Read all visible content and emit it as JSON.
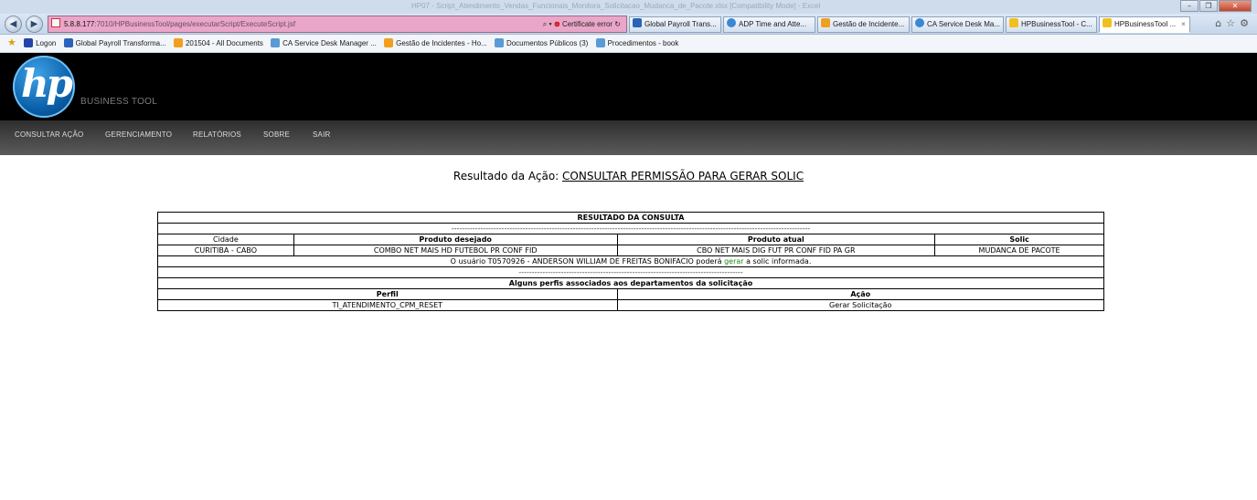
{
  "browser": {
    "window_title": "HP07 - Script_Atendimento_Vendas_Funcionais_Monitora_Solicitacao_Mudanca_de_Pacote.xlsx [Compatibility Mode] - Excel",
    "url_host": "5.8.8.177",
    "url_rest": ":7010/HPBusinessTool/pages/executarScript/ExecuteScript.jsf",
    "certificate_error": "Certificate error",
    "tabs": [
      {
        "label": "Global Payroll Trans...",
        "color": "#2a63b8"
      },
      {
        "label": "ADP Time and Atte...",
        "color": "#3a87d6"
      },
      {
        "label": "Gestão de Incidente...",
        "color": "#f0a020"
      },
      {
        "label": "CA Service Desk Ma...",
        "color": "#3a87d6"
      },
      {
        "label": "HPBusinessTool - C...",
        "color": "#f0c020"
      },
      {
        "label": "HPBusinessTool ...",
        "color": "#f0c020"
      }
    ],
    "favorites": [
      {
        "label": "Logon",
        "color": "#2244aa"
      },
      {
        "label": "Global Payroll Transforma...",
        "color": "#2a63b8"
      },
      {
        "label": "201504 - All Documents",
        "color": "#f0a020"
      },
      {
        "label": "CA Service Desk Manager ...",
        "color": "#5a9ad6"
      },
      {
        "label": "Gestão de Incidentes - Ho...",
        "color": "#f0a020"
      },
      {
        "label": "Documentos Públicos (3)",
        "color": "#5a9ad6"
      },
      {
        "label": "Procedimentos - book",
        "color": "#5a9ad6"
      }
    ]
  },
  "header": {
    "logo_text": "hp",
    "brand_sub": "BUSINESS TOOL"
  },
  "menu": {
    "items": [
      {
        "label": "CONSULTAR AÇÃO"
      },
      {
        "label": "GERENCIAMENTO"
      },
      {
        "label": "RELATÓRIOS"
      },
      {
        "label": "SOBRE"
      },
      {
        "label": "SAIR"
      }
    ]
  },
  "result": {
    "heading_prefix": "Resultado da Ação: ",
    "action_name": "CONSULTAR PERMISSÃO PARA GERAR SOLIC",
    "table_title": "RESULTADO DA CONSULTA",
    "separator": "----------------------------------------------------------------------------------------------------------------------------------------",
    "columns": [
      "Cidade",
      "Produto desejado",
      "Produto atual",
      "Solic"
    ],
    "row": [
      "CURITIBA - CABO",
      "COMBO NET MAIS HD FUTEBOL PR CONF FID",
      "CBO NET MAIS DIG FUT PR CONF FID PA GR",
      "MUDANCA DE PACOTE"
    ],
    "message_before": "O usuário T0570926 - ANDERSON WILLIAM DE FREITAS BONIFACIO poderá ",
    "message_verb": "gerar",
    "message_after": " a solic informada.",
    "separator2": "-------------------------------------------------------------------------------------",
    "profiles_title": "Alguns perfis associados aos departamentos da solicitação",
    "profile_columns": [
      "Perfil",
      "Ação"
    ],
    "profile_row": [
      "TI_ATENDIMENTO_CPM_RESET",
      "Gerar Solicitação"
    ]
  }
}
